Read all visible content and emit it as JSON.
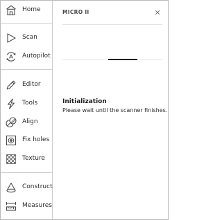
{
  "sidebar": {
    "items": [
      {
        "id": "home",
        "label": "Home",
        "icon": "home-icon"
      },
      {
        "id": "scan",
        "label": "Scan",
        "icon": "scan-play-icon"
      },
      {
        "id": "autopilot",
        "label": "Autopilot",
        "icon": "autopilot-icon"
      },
      {
        "id": "editor",
        "label": "Editor",
        "icon": "pencil-icon"
      },
      {
        "id": "tools",
        "label": "Tools",
        "icon": "lightning-icon"
      },
      {
        "id": "align",
        "label": "Align",
        "icon": "align-icon"
      },
      {
        "id": "fix-holes",
        "label": "Fix holes",
        "icon": "fix-holes-icon"
      },
      {
        "id": "texture",
        "label": "Texture",
        "icon": "texture-checker-icon"
      },
      {
        "id": "construct",
        "label": "Construct",
        "icon": "cone-icon"
      },
      {
        "id": "measures",
        "label": "Measures",
        "icon": "ruler-icon"
      }
    ]
  },
  "panel": {
    "title": "MICRO II",
    "close_icon": "close-icon",
    "progress": {
      "state": "indeterminate"
    },
    "status_title": "Initialization",
    "status_message": "Please wait until the scanner finishes."
  },
  "colors": {
    "border": "#b9b9b9",
    "divider": "#cfcfcf",
    "text": "#2b2b2b",
    "progress": "#1f1f1f"
  }
}
